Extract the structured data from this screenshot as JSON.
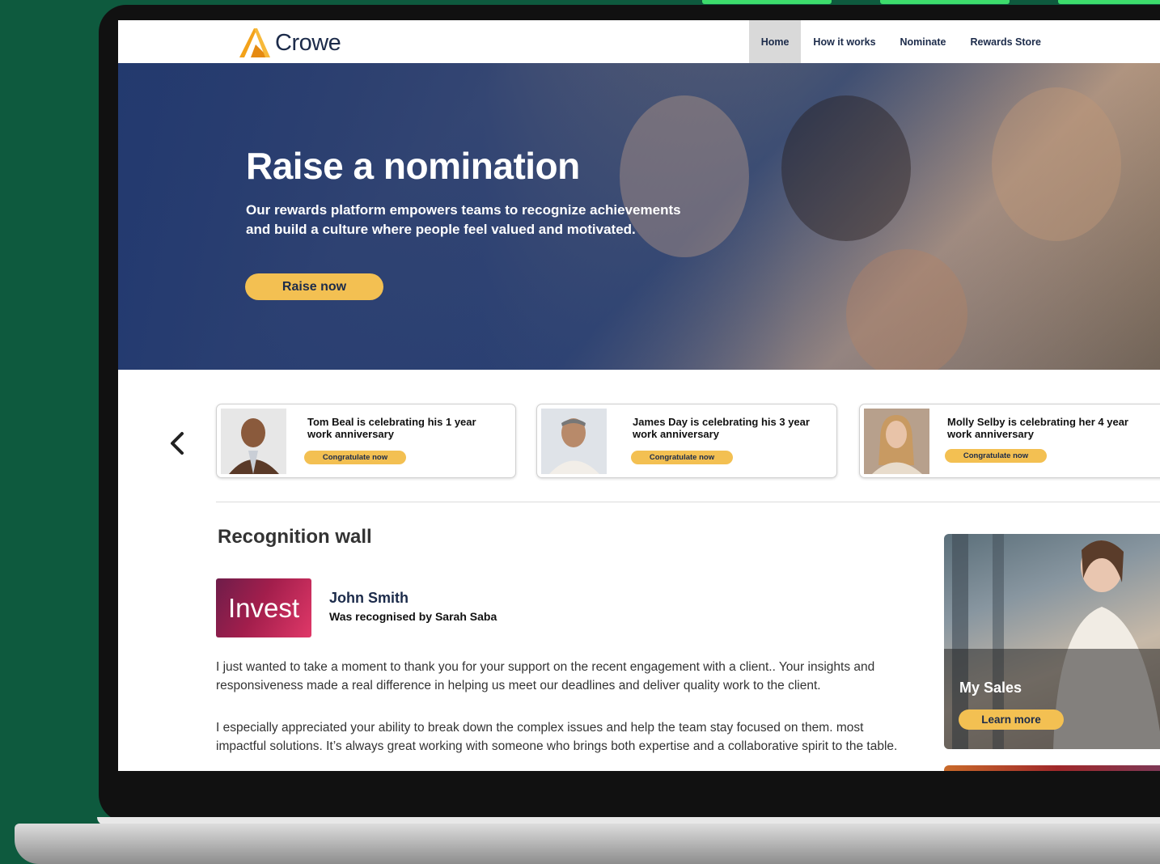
{
  "brand": {
    "name": "Crowe",
    "accent": "#f3c052",
    "navy": "#1c2b4a",
    "background_green": "#0e5a3e"
  },
  "nav": {
    "items": [
      {
        "label": "Home",
        "active": true
      },
      {
        "label": "How it works",
        "active": false
      },
      {
        "label": "Nominate",
        "active": false
      },
      {
        "label": "Rewards Store",
        "active": false
      }
    ]
  },
  "hero": {
    "title": "Raise a nomination",
    "subtitle": "Our rewards platform empowers teams to recognize achievements and build a culture where people feel valued and motivated.",
    "button": "Raise now"
  },
  "anniversaries": {
    "prev_icon": "chevron-left-icon",
    "cards": [
      {
        "text": "Tom Beal is celebrating his 1 year work anniversary",
        "button": "Congratulate now"
      },
      {
        "text": "James Day is celebrating his 3 year work anniversary",
        "button": "Congratulate now"
      },
      {
        "text": "Molly Selby is celebrating her 4 year work anniversary",
        "button": "Congratulate now"
      }
    ]
  },
  "recognition_wall": {
    "title": "Recognition wall",
    "tile_label": "Invest",
    "name": "John Smith",
    "recognised_by": "Was recognised by Sarah Saba",
    "message_1": "I just wanted to take a moment to thank you for your support on the recent engagement with a client.. Your insights and responsiveness made a real difference in helping us meet our deadlines and deliver quality work to the client.",
    "message_2": "I especially appreciated your ability to break down the complex issues and help the team stay focused on them. most impactful solutions. It’s always great working with someone who brings both expertise and a collaborative spirit to the table."
  },
  "side_card": {
    "title": "My Sales",
    "button": "Learn more"
  }
}
